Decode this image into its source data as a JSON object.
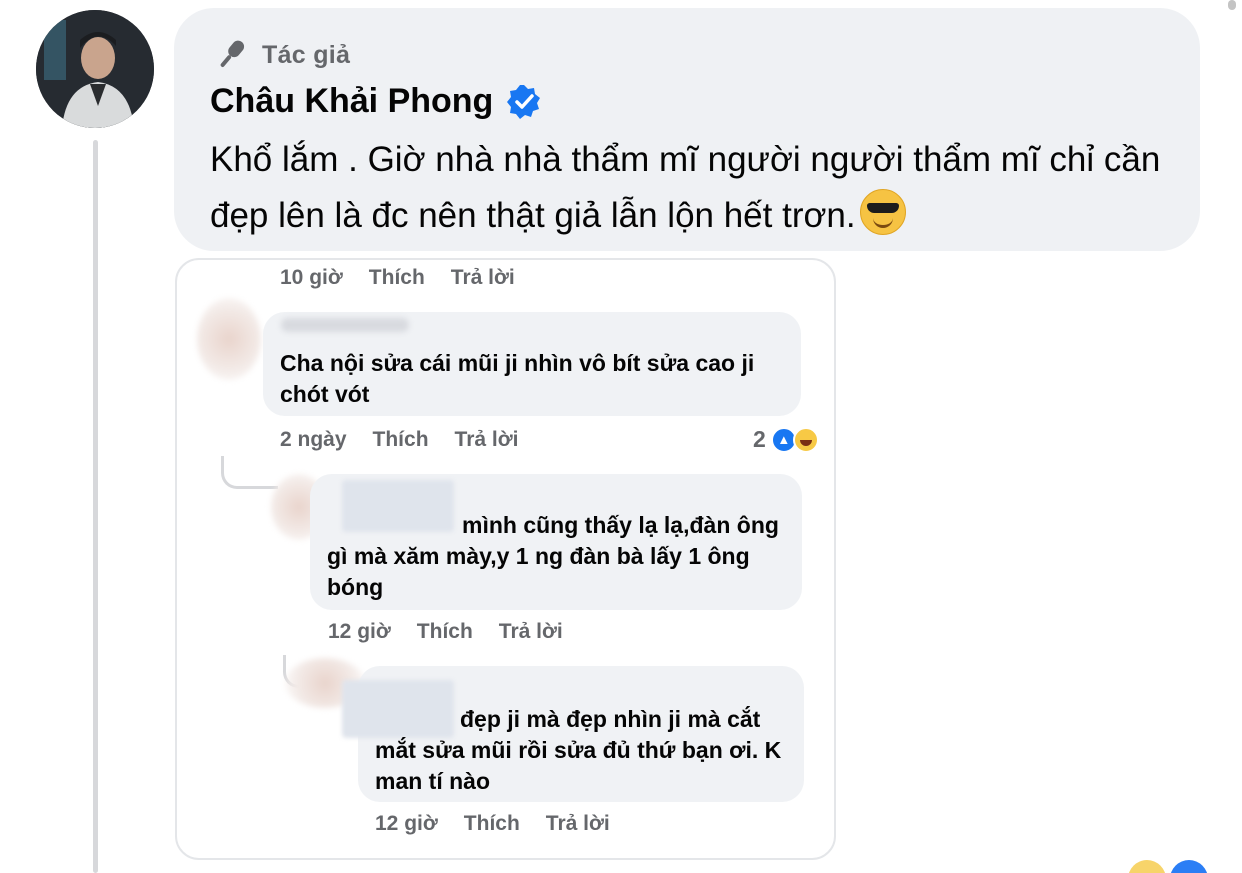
{
  "author_comment": {
    "badge_label": "Tác giả",
    "name": "Châu Khải Phong",
    "text": "Khổ lắm . Giờ nhà nhà thẩm mĩ người người thẩm mĩ chỉ cần đẹp lên là đc nên thật giả lẫn lộn hết trơn."
  },
  "screenshot": {
    "top_meta": {
      "time": "10 giờ",
      "like": "Thích",
      "reply": "Trả lời"
    },
    "comment_1": {
      "text": "Cha nội sửa cái mũi ji nhìn vô bít sửa cao ji chót vót",
      "time": "2 ngày",
      "like": "Thích",
      "reply": "Trả lời",
      "reaction_count": "2"
    },
    "reply_1": {
      "text": "mình cũng thấy lạ lạ,đàn ông gì mà xăm mày,y 1 ng đàn bà lấy 1 ông bóng",
      "time": "12 giờ",
      "like": "Thích",
      "reply": "Trả lời"
    },
    "reply_2": {
      "text": "đẹp ji mà đẹp nhìn ji mà cắt mắt sửa mũi rồi sửa đủ thứ bạn ơi. K man tí nào",
      "time": "12 giờ",
      "like": "Thích",
      "reply": "Trả lời"
    }
  },
  "colors": {
    "bubble_bg": "#eff1f4",
    "verified_blue": "#1877f2",
    "meta_gray": "#65676b"
  },
  "icons": [
    "microphone-icon",
    "verified-badge-icon",
    "sunglasses-emoji-icon",
    "like-reaction-icon",
    "haha-reaction-icon"
  ]
}
